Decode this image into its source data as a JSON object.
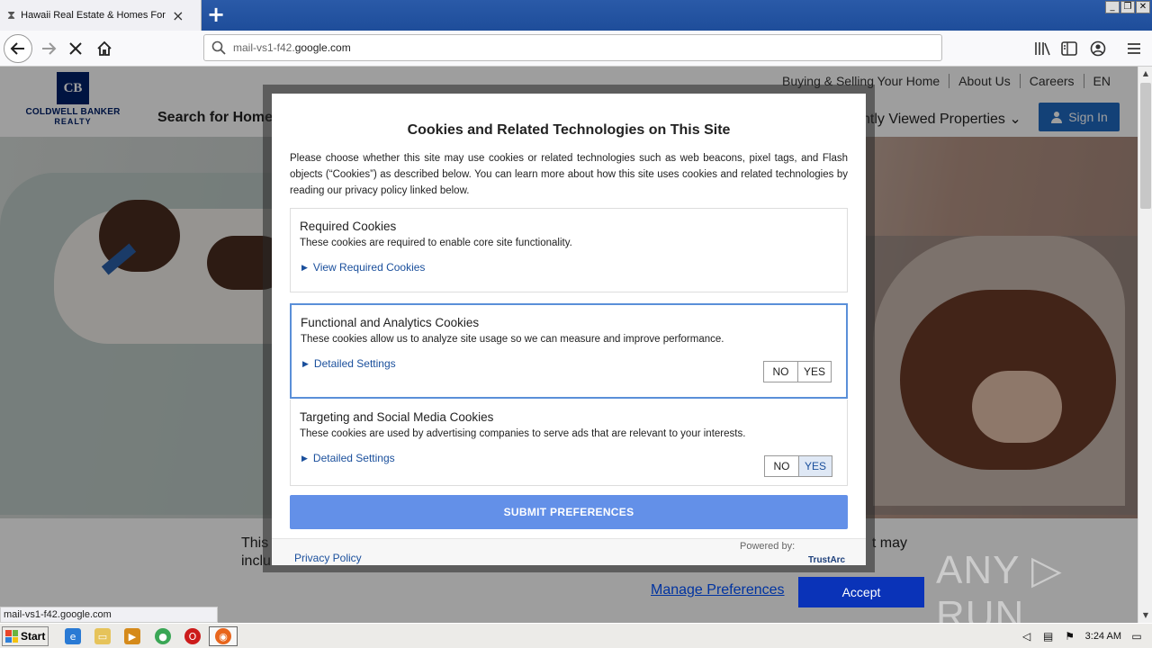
{
  "browser": {
    "tab_title": "Hawaii Real Estate & Homes For S",
    "tab_close": "×",
    "new_tab": "+",
    "url_dim": "mail-vs1-f42.",
    "url_main": "google.com",
    "status_url": "mail-vs1-f42.google.com",
    "window_controls": [
      "_",
      "❐",
      "✕"
    ]
  },
  "site": {
    "logo_letters": "CB",
    "logo_line1": "COLDWELL BANKER",
    "logo_line2": "REALTY",
    "toplinks": [
      "Buying & Selling Your Home",
      "About Us",
      "Careers",
      "EN"
    ],
    "search_homes": "Search for Homes",
    "recent_props": "ntly Viewed Properties ⌄",
    "signin": "Sign In",
    "banner_text_1": "This",
    "banner_text_2": "inclu",
    "banner_text_3": "t may",
    "manage_prefs": "Manage Preferences",
    "accept": "Accept"
  },
  "modal": {
    "title": "Cookies and Related Technologies on This Site",
    "intro": "Please choose whether this site may use cookies or related technologies such as web beacons, pixel tags, and Flash objects (“Cookies”) as described below. You can learn more about how this site uses cookies and related technologies by reading our privacy policy linked below.",
    "categories": [
      {
        "title": "Required Cookies",
        "desc": "These cookies are required to enable core site functionality.",
        "link": "View Required Cookies"
      },
      {
        "title": "Functional and Analytics Cookies",
        "desc": "These cookies allow us to analyze site usage so we can measure and improve performance.",
        "link": "Detailed Settings",
        "no": "NO",
        "yes": "YES",
        "selected": "none"
      },
      {
        "title": "Targeting and Social Media Cookies",
        "desc": "These cookies are used by advertising companies to serve ads that are relevant to your interests.",
        "link": "Detailed Settings",
        "no": "NO",
        "yes": "YES",
        "selected": "YES"
      }
    ],
    "submit": "SUBMIT PREFERENCES",
    "privacy_policy": "Privacy Policy",
    "powered_by": "Powered by:",
    "trustarc": "TrustArc"
  },
  "watermark": "ANY ▷ RUN",
  "taskbar": {
    "start": "Start",
    "time": "3:24 AM"
  },
  "colors": {
    "brand": "#012169",
    "signin": "#1f69c1",
    "submit": "#6390e8",
    "accept": "#0a33b8"
  }
}
